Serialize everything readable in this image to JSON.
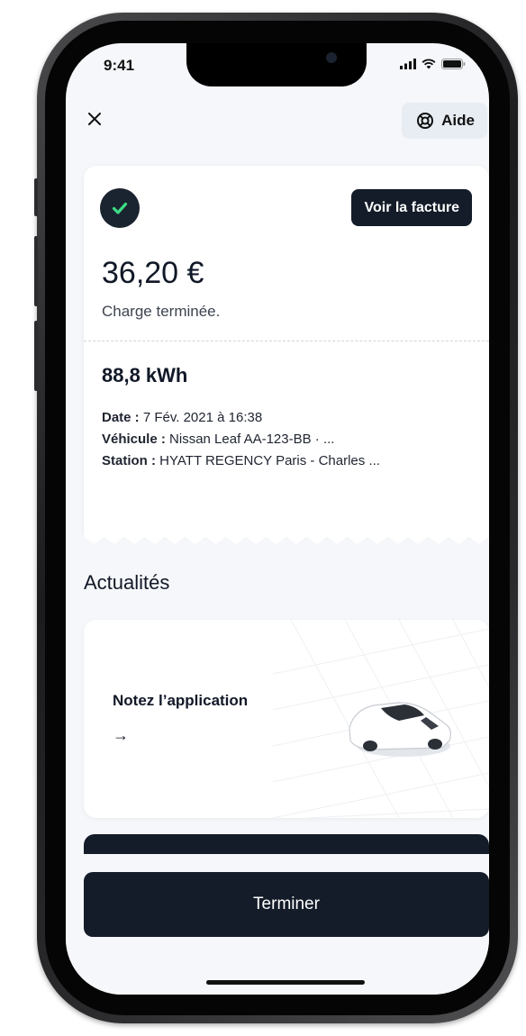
{
  "status_bar": {
    "time": "9:41"
  },
  "header": {
    "close_icon": "close-icon",
    "help_label": "Aide",
    "help_icon": "lifebuoy-icon"
  },
  "receipt": {
    "status_icon": "check-icon",
    "invoice_button_label": "Voir la facture",
    "amount": "36,20 €",
    "status_text": "Charge terminée.",
    "energy": "88,8 kWh",
    "details": [
      {
        "label": "Date :",
        "value": " 7 Fév. 2021 à 16:38"
      },
      {
        "label": "Véhicule :",
        "value": " Nissan Leaf AA-123-BB · ..."
      },
      {
        "label": "Station :",
        "value": " HYATT REGENCY Paris - Charles ..."
      }
    ]
  },
  "news": {
    "section_title": "Actualités",
    "card_title": "Notez l’application",
    "card_arrow": "→",
    "card_image": "white-car-illustration"
  },
  "footer": {
    "finish_button_label": "Terminer"
  },
  "colors": {
    "screen_background": "#f5f7fa",
    "dark_accent": "#141b29",
    "success_green": "#3ddc84",
    "help_button_bg": "#e8edf3"
  }
}
